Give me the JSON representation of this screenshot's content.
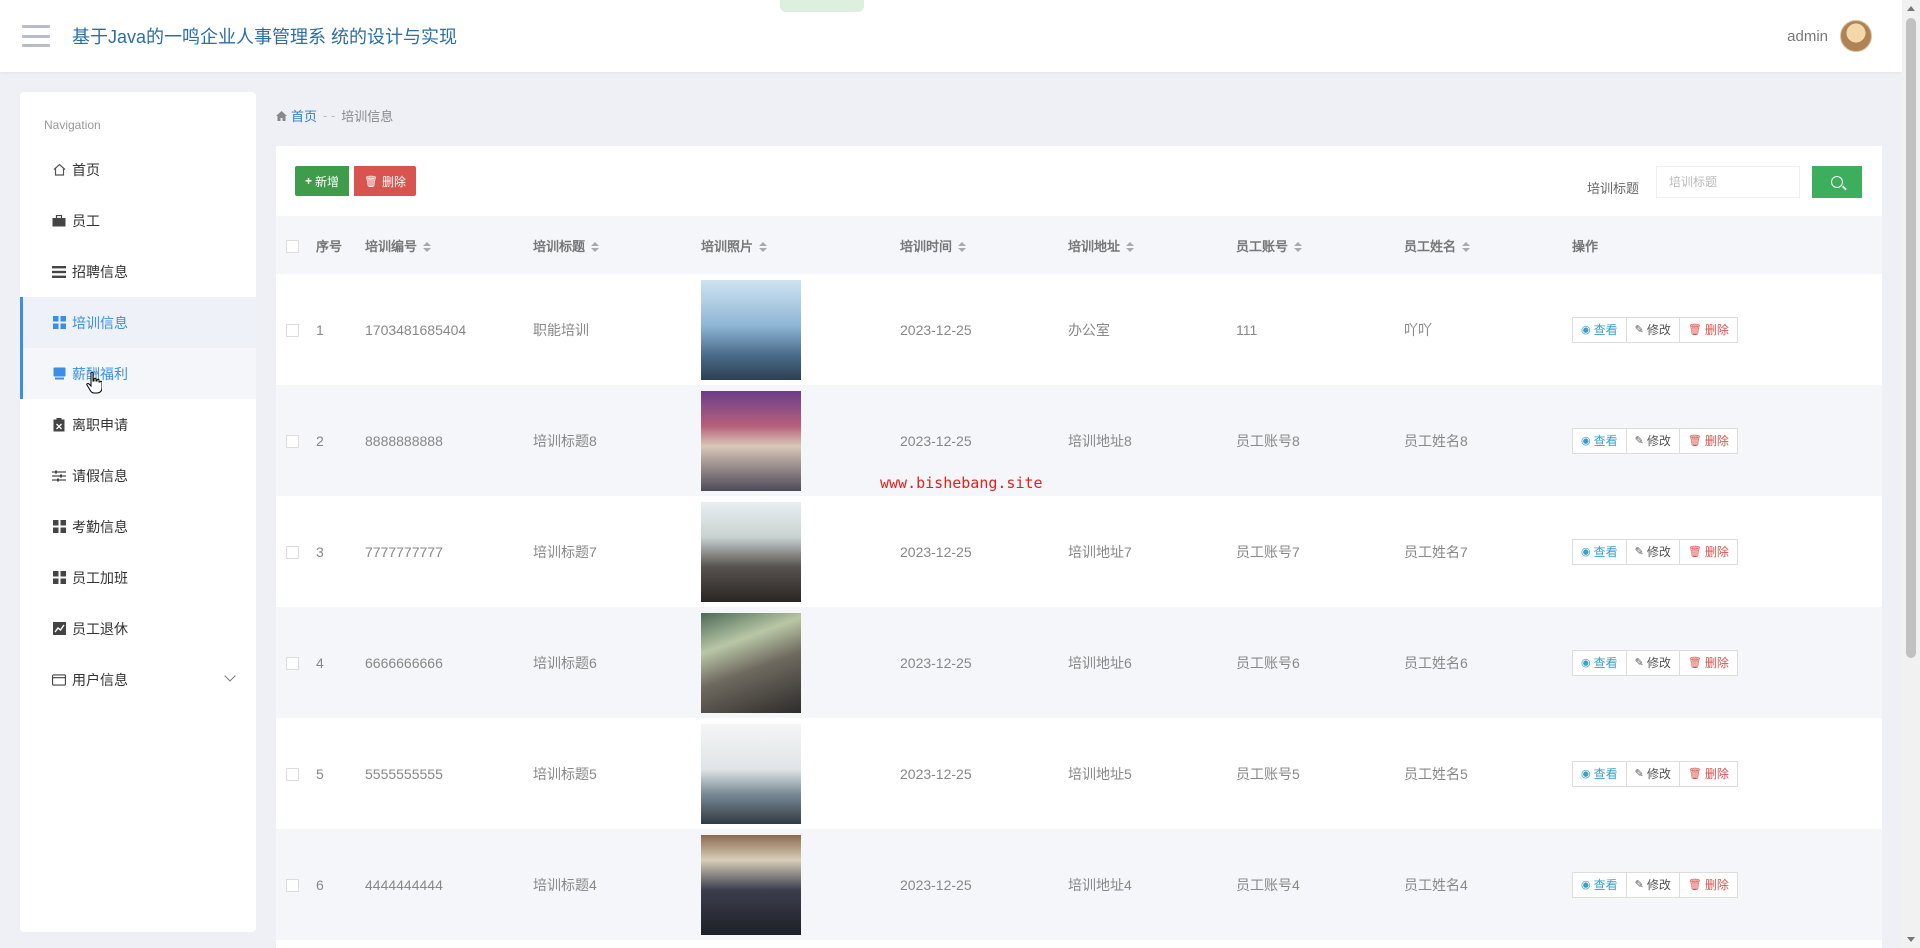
{
  "header": {
    "title": "基于Java的一鸣企业人事管理系 统的设计与实现",
    "user": "admin"
  },
  "sidebar": {
    "heading": "Navigation",
    "items": [
      {
        "label": "首页",
        "icon": "home-icon"
      },
      {
        "label": "员工",
        "icon": "briefcase-icon"
      },
      {
        "label": "招聘信息",
        "icon": "list-icon"
      },
      {
        "label": "培训信息",
        "icon": "grid-icon"
      },
      {
        "label": "薪酬福利",
        "icon": "book-icon"
      },
      {
        "label": "离职申请",
        "icon": "clipboard-icon"
      },
      {
        "label": "请假信息",
        "icon": "sliders-icon"
      },
      {
        "label": "考勤信息",
        "icon": "grid-icon"
      },
      {
        "label": "员工加班",
        "icon": "grid-icon"
      },
      {
        "label": "员工退休",
        "icon": "chart-icon"
      },
      {
        "label": "用户信息",
        "icon": "card-icon"
      }
    ]
  },
  "breadcrumb": {
    "home": "首页",
    "separator": "- -",
    "current": "培训信息"
  },
  "toolbar": {
    "add_label": "新增",
    "delete_label": "删除",
    "search_label": "培训标题",
    "search_placeholder": "培训标题"
  },
  "table": {
    "headers": [
      "序号",
      "培训编号",
      "培训标题",
      "培训照片",
      "培训时间",
      "培训地址",
      "员工账号",
      "员工姓名",
      "操作"
    ],
    "actions": {
      "view": "查看",
      "edit": "修改",
      "remove": "删除"
    },
    "rows": [
      {
        "no": "1",
        "code": "1703481685404",
        "title": "职能培训",
        "time": "2023-12-25",
        "address": "办公室",
        "account": "111",
        "name": "吖吖"
      },
      {
        "no": "2",
        "code": "8888888888",
        "title": "培训标题8",
        "time": "2023-12-25",
        "address": "培训地址8",
        "account": "员工账号8",
        "name": "员工姓名8"
      },
      {
        "no": "3",
        "code": "7777777777",
        "title": "培训标题7",
        "time": "2023-12-25",
        "address": "培训地址7",
        "account": "员工账号7",
        "name": "员工姓名7"
      },
      {
        "no": "4",
        "code": "6666666666",
        "title": "培训标题6",
        "time": "2023-12-25",
        "address": "培训地址6",
        "account": "员工账号6",
        "name": "员工姓名6"
      },
      {
        "no": "5",
        "code": "5555555555",
        "title": "培训标题5",
        "time": "2023-12-25",
        "address": "培训地址5",
        "account": "员工账号5",
        "name": "员工姓名5"
      },
      {
        "no": "6",
        "code": "4444444444",
        "title": "培训标题4",
        "time": "2023-12-25",
        "address": "培训地址4",
        "account": "员工账号4",
        "name": "员工姓名4"
      }
    ]
  },
  "watermark": "www.bishebang.site"
}
